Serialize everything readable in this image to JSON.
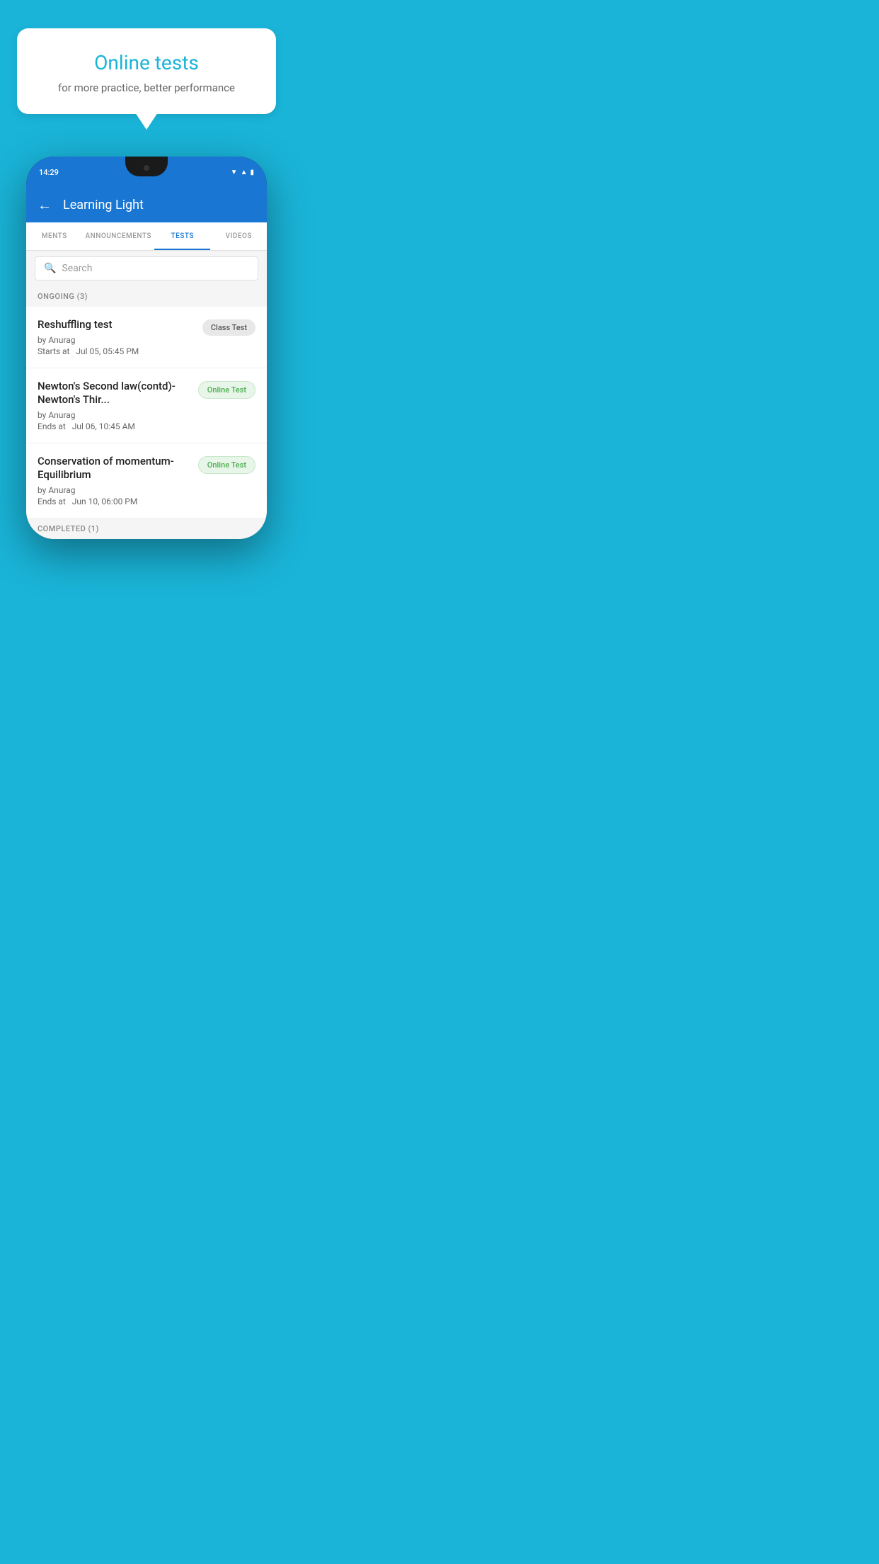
{
  "background": {
    "color": "#1ab4d8"
  },
  "promo": {
    "title": "Online tests",
    "subtitle": "for more practice, better performance"
  },
  "app": {
    "time": "14:29",
    "title": "Learning Light",
    "back_label": "←"
  },
  "tabs": [
    {
      "id": "ments",
      "label": "MENTS",
      "active": false
    },
    {
      "id": "announcements",
      "label": "ANNOUNCEMENTS",
      "active": false
    },
    {
      "id": "tests",
      "label": "TESTS",
      "active": true
    },
    {
      "id": "videos",
      "label": "VIDEOS",
      "active": false
    }
  ],
  "search": {
    "placeholder": "Search"
  },
  "ongoing": {
    "header": "ONGOING (3)",
    "tests": [
      {
        "title": "Reshuffling test",
        "author": "by Anurag",
        "time": "Starts at  Jul 05, 05:45 PM",
        "badge": "Class Test",
        "badge_type": "class"
      },
      {
        "title": "Newton's Second law(contd)-Newton's Thir...",
        "author": "by Anurag",
        "time": "Ends at  Jul 06, 10:45 AM",
        "badge": "Online Test",
        "badge_type": "online"
      },
      {
        "title": "Conservation of momentum-Equilibrium",
        "author": "by Anurag",
        "time": "Ends at  Jun 10, 06:00 PM",
        "badge": "Online Test",
        "badge_type": "online"
      }
    ]
  },
  "completed": {
    "header": "COMPLETED (1)"
  }
}
